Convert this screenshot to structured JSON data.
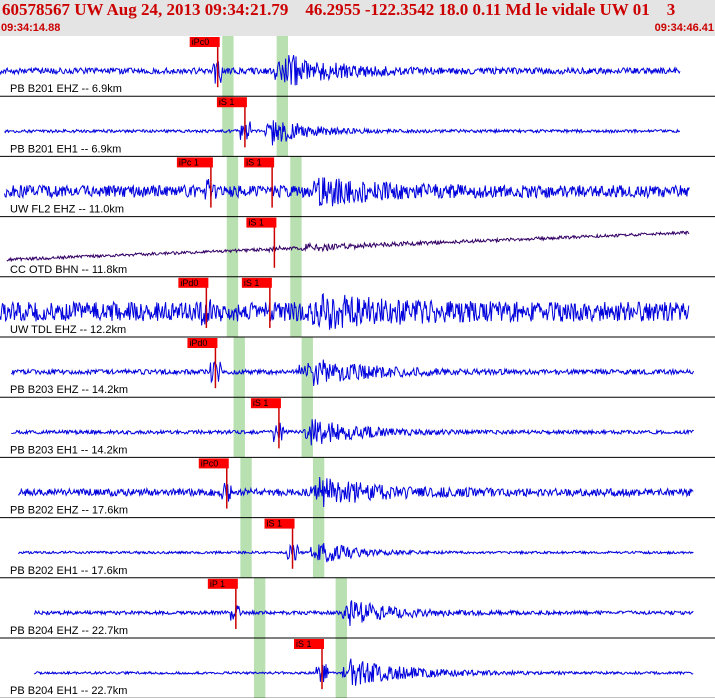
{
  "header": {
    "title": "60578567 UW Aug 24, 2013 09:34:21.79    46.2955 -122.3542 18.0 0.11 Md le vidale UW 01    3",
    "start_time": "09:34:14.88",
    "end_time": "09:34:46.41"
  },
  "colors": {
    "trace": "#0000dd",
    "trace_dark": "#330066",
    "pick_box": "#ff0000",
    "pick_line": "#cc0000",
    "window_band": "#b8e0b0",
    "header_bg": "#e4e4e4",
    "header_text": "#cc0000",
    "divider": "#000000"
  },
  "chart_data": {
    "type": "line",
    "title": "60578567 UW Aug 24, 2013 09:34:21.79    46.2955 -122.3542 18.0 0.11 Md le vidale UW 01    3",
    "x_range": [
      "09:34:14.88",
      "09:34:46.41"
    ],
    "x_range_seconds": [
      0,
      31.53
    ],
    "traces": [
      {
        "label": "PB B201 EHZ -- 6.9km",
        "data_start_s": 0.0,
        "data_end_s": 30.0,
        "noise": 0.1,
        "amp": 0.55,
        "decay": 2.2,
        "dark": false,
        "drift": 0,
        "pick": {
          "label": "iPc0",
          "time_s": 9.6
        },
        "event_time_s": 12.4,
        "bands": [
          {
            "start_s": 9.8,
            "end_s": 10.3
          },
          {
            "start_s": 12.2,
            "end_s": 12.7
          }
        ]
      },
      {
        "label": "PB B201 EH1 -- 6.9km",
        "data_start_s": 0.2,
        "data_end_s": 30.0,
        "noise": 0.05,
        "amp": 0.45,
        "decay": 1.5,
        "dark": false,
        "drift": 0,
        "pick": {
          "label": "iS 1",
          "time_s": 10.8
        },
        "event_time_s": 12.0,
        "bands": [
          {
            "start_s": 9.8,
            "end_s": 10.3
          },
          {
            "start_s": 12.2,
            "end_s": 12.7
          }
        ]
      },
      {
        "label": "UW FL2 EHZ -- 11.0km",
        "data_start_s": 0.2,
        "data_end_s": 30.4,
        "noise": 0.2,
        "amp": 0.4,
        "decay": 2.5,
        "dark": false,
        "drift": 0,
        "pick": {
          "label": "iPc 1",
          "time_s": 9.3
        },
        "event_time_s": 14.0,
        "second_pick": {
          "label": "iS 1",
          "time_s": 12.0
        },
        "bands": [
          {
            "start_s": 10.0,
            "end_s": 10.5
          },
          {
            "start_s": 12.8,
            "end_s": 13.3
          }
        ]
      },
      {
        "label": "CC OTD BHN -- 11.8km",
        "data_start_s": 0.3,
        "data_end_s": 30.4,
        "noise": 0.05,
        "amp": 0.1,
        "decay": 3.0,
        "dark": true,
        "drift": 0.45,
        "pick": {
          "label": "iS 1",
          "time_s": 12.1
        },
        "event_time_s": 13.4,
        "bands": [
          {
            "start_s": 10.0,
            "end_s": 10.5
          },
          {
            "start_s": 12.8,
            "end_s": 13.3
          }
        ]
      },
      {
        "label": "UW TDL EHZ -- 12.2km",
        "data_start_s": 0.0,
        "data_end_s": 30.4,
        "noise": 0.32,
        "amp": 0.38,
        "decay": 3.0,
        "dark": false,
        "drift": 0,
        "pick": {
          "label": "iPd0",
          "time_s": 9.1
        },
        "event_time_s": 14.0,
        "second_pick": {
          "label": "iS 1",
          "time_s": 11.9
        },
        "bands": [
          {
            "start_s": 10.0,
            "end_s": 10.5
          },
          {
            "start_s": 12.8,
            "end_s": 13.3
          }
        ]
      },
      {
        "label": "PB B203 EHZ -- 14.2km",
        "data_start_s": 0.5,
        "data_end_s": 30.6,
        "noise": 0.08,
        "amp": 0.45,
        "decay": 2.5,
        "dark": false,
        "drift": 0,
        "pick": {
          "label": "iPd0",
          "time_s": 9.5
        },
        "event_time_s": 13.5,
        "bands": [
          {
            "start_s": 10.3,
            "end_s": 10.8
          },
          {
            "start_s": 13.3,
            "end_s": 13.8
          }
        ]
      },
      {
        "label": "PB B203 EH1 -- 14.2km",
        "data_start_s": 0.5,
        "data_end_s": 30.6,
        "noise": 0.06,
        "amp": 0.45,
        "decay": 2.0,
        "dark": false,
        "drift": 0,
        "pick": {
          "label": "iS 1",
          "time_s": 12.3
        },
        "event_time_s": 13.7,
        "bands": [
          {
            "start_s": 10.3,
            "end_s": 10.8
          },
          {
            "start_s": 13.3,
            "end_s": 13.8
          }
        ]
      },
      {
        "label": "PB B202 EHZ -- 17.6km",
        "data_start_s": 0.8,
        "data_end_s": 30.6,
        "noise": 0.12,
        "amp": 0.45,
        "decay": 2.5,
        "dark": false,
        "drift": 0,
        "pick": {
          "label": "iPc0",
          "time_s": 10.0
        },
        "event_time_s": 14.0,
        "bands": [
          {
            "start_s": 10.6,
            "end_s": 11.1
          },
          {
            "start_s": 13.8,
            "end_s": 14.3
          }
        ]
      },
      {
        "label": "PB B202 EH1 -- 17.6km",
        "data_start_s": 0.8,
        "data_end_s": 30.6,
        "noise": 0.04,
        "amp": 0.4,
        "decay": 1.5,
        "dark": false,
        "drift": 0,
        "pick": {
          "label": "iS 1",
          "time_s": 12.9
        },
        "event_time_s": 14.0,
        "bands": [
          {
            "start_s": 10.6,
            "end_s": 11.1
          },
          {
            "start_s": 13.8,
            "end_s": 14.3
          }
        ]
      },
      {
        "label": "PB B204 EHZ -- 22.7km",
        "data_start_s": 1.5,
        "data_end_s": 30.6,
        "noise": 0.06,
        "amp": 0.4,
        "decay": 2.0,
        "dark": false,
        "drift": 0,
        "pick": {
          "label": "iP 1",
          "time_s": 10.4
        },
        "event_time_s": 15.4,
        "bands": [
          {
            "start_s": 11.2,
            "end_s": 11.7
          },
          {
            "start_s": 14.8,
            "end_s": 15.3
          }
        ]
      },
      {
        "label": "PB B204 EH1 -- 22.7km",
        "data_start_s": 1.5,
        "data_end_s": 30.6,
        "noise": 0.04,
        "amp": 0.45,
        "decay": 2.5,
        "dark": false,
        "drift": 0,
        "pick": {
          "label": "iS 1",
          "time_s": 14.2
        },
        "event_time_s": 15.4,
        "bands": [
          {
            "start_s": 11.2,
            "end_s": 11.7
          },
          {
            "start_s": 14.8,
            "end_s": 15.3
          }
        ]
      }
    ],
    "grid": false
  }
}
